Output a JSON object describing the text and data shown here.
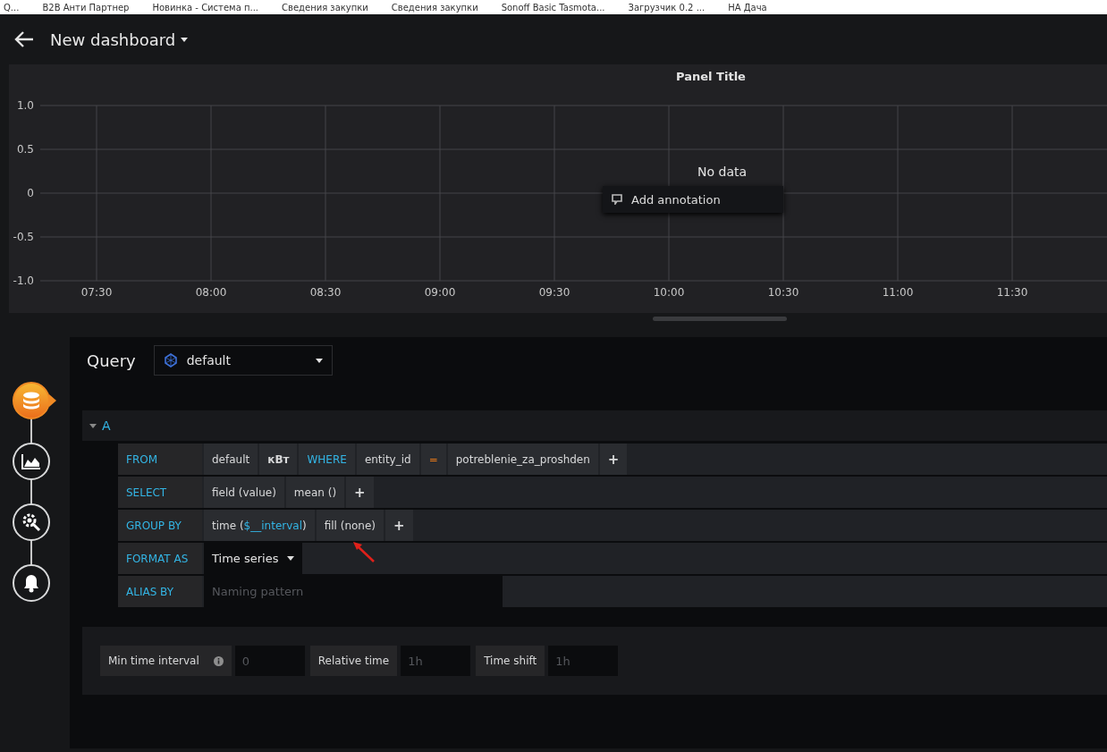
{
  "bookmarks": [
    {
      "label": "Q..."
    },
    {
      "label": "B2B Анти Партнер"
    },
    {
      "label": "Новинка - Система п..."
    },
    {
      "label": "Сведения закупки"
    },
    {
      "label": "Сведения закупки"
    },
    {
      "label": "Sonoff Basic Tasmota..."
    },
    {
      "label": "Загрузчик 0.2 ..."
    },
    {
      "label": "НА Дача"
    }
  ],
  "header": {
    "title": "New dashboard"
  },
  "panel": {
    "title": "Panel Title",
    "message": "No data",
    "context_menu": {
      "item": "Add annotation"
    },
    "chart_data": {
      "type": "line",
      "grid": true,
      "yticks": [
        {
          "value": 1,
          "label": "1.0"
        },
        {
          "value": 0.5,
          "label": "0.5"
        },
        {
          "value": 0,
          "label": "0"
        },
        {
          "value": -0.5,
          "label": "-0.5"
        },
        {
          "value": -1,
          "label": "-1.0"
        }
      ],
      "ylim": [
        -1,
        1
      ],
      "categories": [
        "07:30",
        "08:00",
        "08:30",
        "09:00",
        "09:30",
        "10:00",
        "10:30",
        "11:00",
        "11:30"
      ]
    }
  },
  "steps": [
    {
      "kind": "queries",
      "selected": true
    },
    {
      "kind": "visualization",
      "selected": false
    },
    {
      "kind": "general",
      "selected": false
    },
    {
      "kind": "alert",
      "selected": false
    }
  ],
  "query": {
    "label": "Query",
    "datasource": "default",
    "target": {
      "name": "A",
      "expanded": true,
      "rows": [
        {
          "label": "FROM",
          "kind": "segments",
          "segments": [
            {
              "kind": "plain",
              "text": "default"
            },
            {
              "kind": "measurement",
              "text": "кВт"
            },
            {
              "kind": "keyword",
              "text": "WHERE"
            },
            {
              "kind": "plain",
              "text": "entity_id"
            },
            {
              "kind": "operator",
              "text": "="
            },
            {
              "kind": "plain",
              "text": "potreblenie_za_proshden"
            },
            {
              "kind": "add",
              "text": "+"
            }
          ]
        },
        {
          "label": "SELECT",
          "kind": "segments",
          "segments": [
            {
              "kind": "plain",
              "text": "field (value)"
            },
            {
              "kind": "plain",
              "text": "mean ()"
            },
            {
              "kind": "add",
              "text": "+"
            }
          ]
        },
        {
          "label": "GROUP BY",
          "kind": "segments",
          "segments": [
            {
              "kind": "parts",
              "parts": [
                {
                  "kind": "plain",
                  "text": "time ("
                },
                {
                  "kind": "variable",
                  "text": "$__interval"
                },
                {
                  "kind": "plain",
                  "text": ")"
                }
              ]
            },
            {
              "kind": "plain",
              "text": "fill (none)",
              "pointer": true
            },
            {
              "kind": "add",
              "text": "+"
            }
          ]
        },
        {
          "label": "FORMAT AS",
          "kind": "select",
          "value": "Time series"
        },
        {
          "label": "ALIAS BY",
          "kind": "input",
          "placeholder": "Naming pattern"
        }
      ]
    }
  },
  "options": [
    {
      "label": "Min time interval",
      "info": true,
      "placeholder": "0"
    },
    {
      "label": "Relative time",
      "info": false,
      "placeholder": "1h"
    },
    {
      "label": "Time shift",
      "info": false,
      "placeholder": "1h"
    }
  ]
}
